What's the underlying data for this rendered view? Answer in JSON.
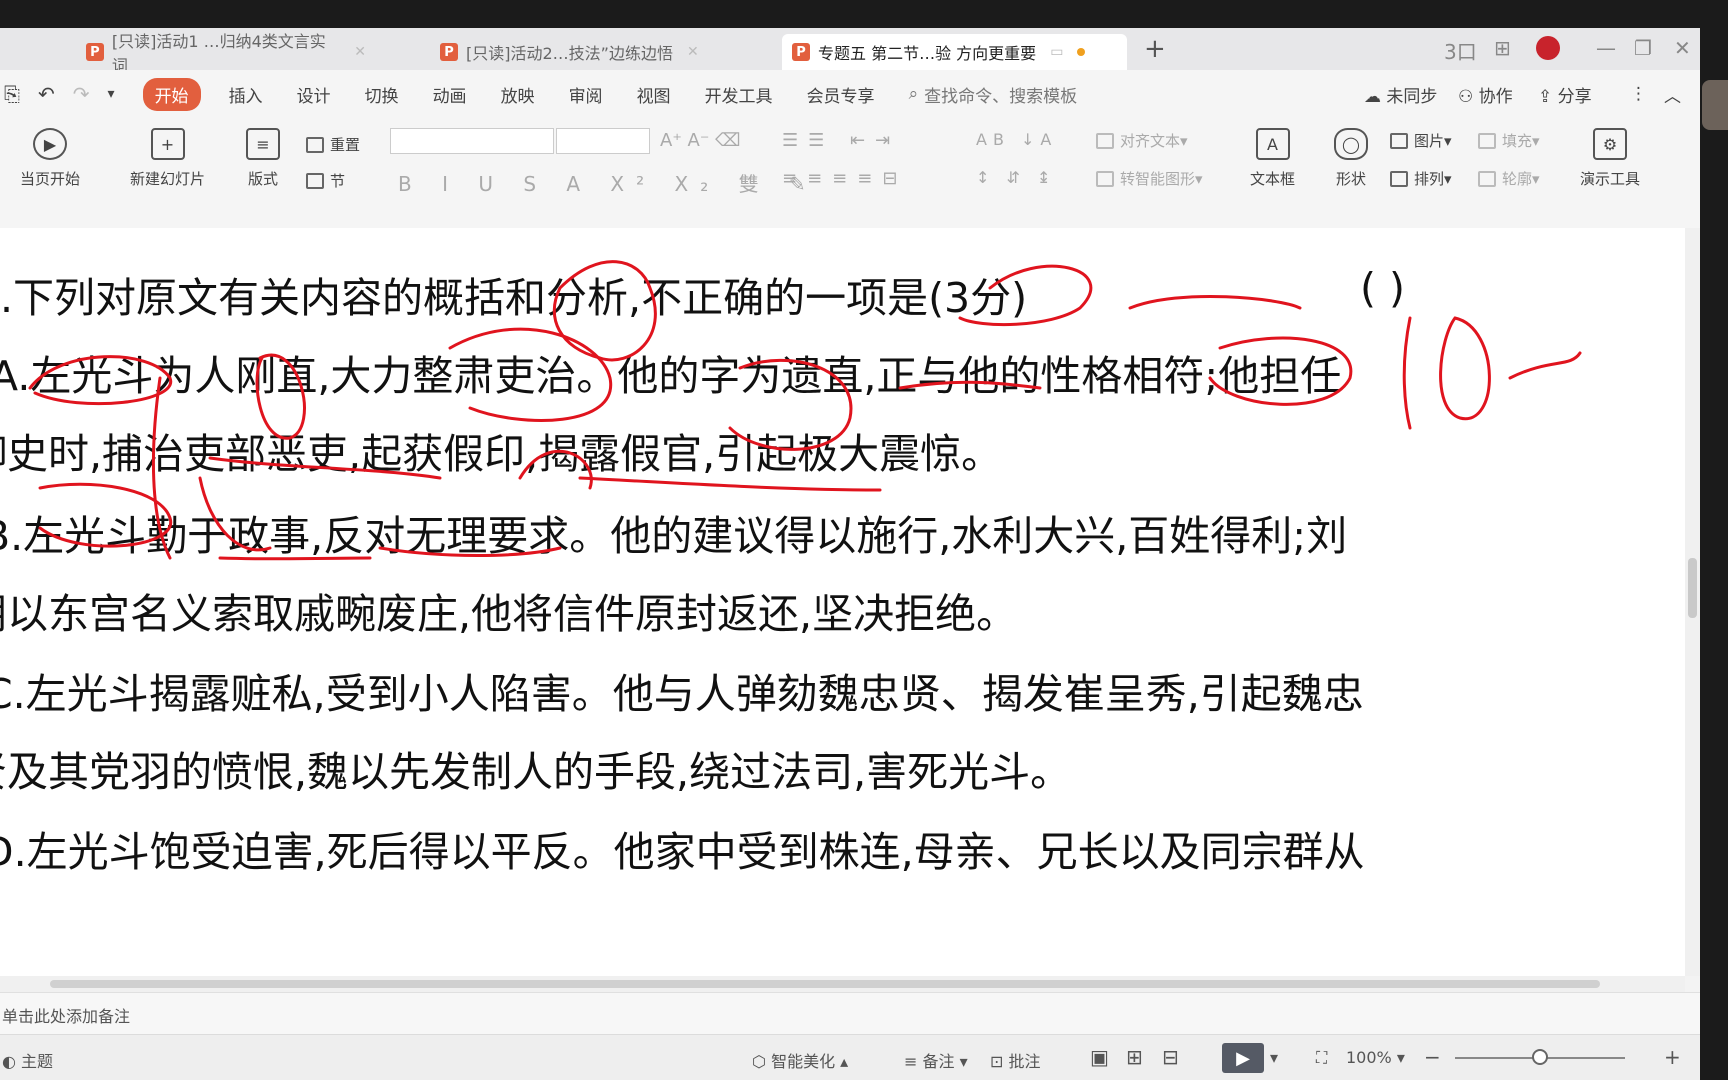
{
  "tabs": [
    {
      "label": "[只读]活动1 …归纳4类文言实词",
      "active": false
    },
    {
      "label": "[只读]活动2…技法”边练边悟",
      "active": false
    },
    {
      "label": "专题五 第二节…验 方向更重要",
      "active": true
    }
  ],
  "window_controls": {
    "new_tab": "+",
    "layout1": "3口",
    "layout2": "⊞",
    "minimize": "—",
    "restore": "❐",
    "close": "✕"
  },
  "menu": {
    "items": [
      "开始",
      "插入",
      "设计",
      "切换",
      "动画",
      "放映",
      "审阅",
      "视图",
      "开发工具",
      "会员专享"
    ],
    "search_placeholder": "查找命令、搜索模板",
    "right": [
      "未同步",
      "协作",
      "分享"
    ]
  },
  "ribbon": {
    "play_from_current": "当页开始",
    "new_slide": "新建幻灯片",
    "layout": "版式",
    "reset": "重置",
    "section": "节",
    "align_text": "对齐文本",
    "convert_smartart": "转智能图形",
    "textbox": "文本框",
    "shapes": "形状",
    "picture": "图片",
    "arrange": "排列",
    "fill": "填充",
    "outline": "轮廓",
    "presentation_tools": "演示工具"
  },
  "slide": {
    "lines": [
      ".下列对原文有关内容的概括和分析,不正确的一项是(3分)",
      "A.左光斗为人刚直,大力整肃吏治。他的字为遗直,正与他的性格相符;他担任",
      "御史时,捕治吏部恶吏,起获假印,揭露假官,引起极大震惊。",
      "B.左光斗勤于政事,反对无理要求。他的建议得以施行,水利大兴,百姓得利;刘",
      "朝以东宫名义索取戚畹废庄,他将信件原封返还,坚决拒绝。",
      "C.左光斗揭露赃私,受到小人陷害。他与人弹劾魏忠贤、揭发崔呈秀,引起魏忠",
      "贤及其党羽的愤恨,魏以先发制人的手段,绕过法司,害死光斗。",
      "D.左光斗饱受迫害,死后得以平反。他家中受到株连,母亲、兄长以及同宗群从"
    ],
    "answer_brackets": "(        )",
    "ink_color": "#e0141e"
  },
  "notes": {
    "placeholder": "单击此处添加备注"
  },
  "status": {
    "theme": "主题",
    "beautify": "智能美化",
    "notes_btn": "备注",
    "comment_btn": "批注",
    "zoom": "100%",
    "zoom_level_fraction": 0.5
  }
}
